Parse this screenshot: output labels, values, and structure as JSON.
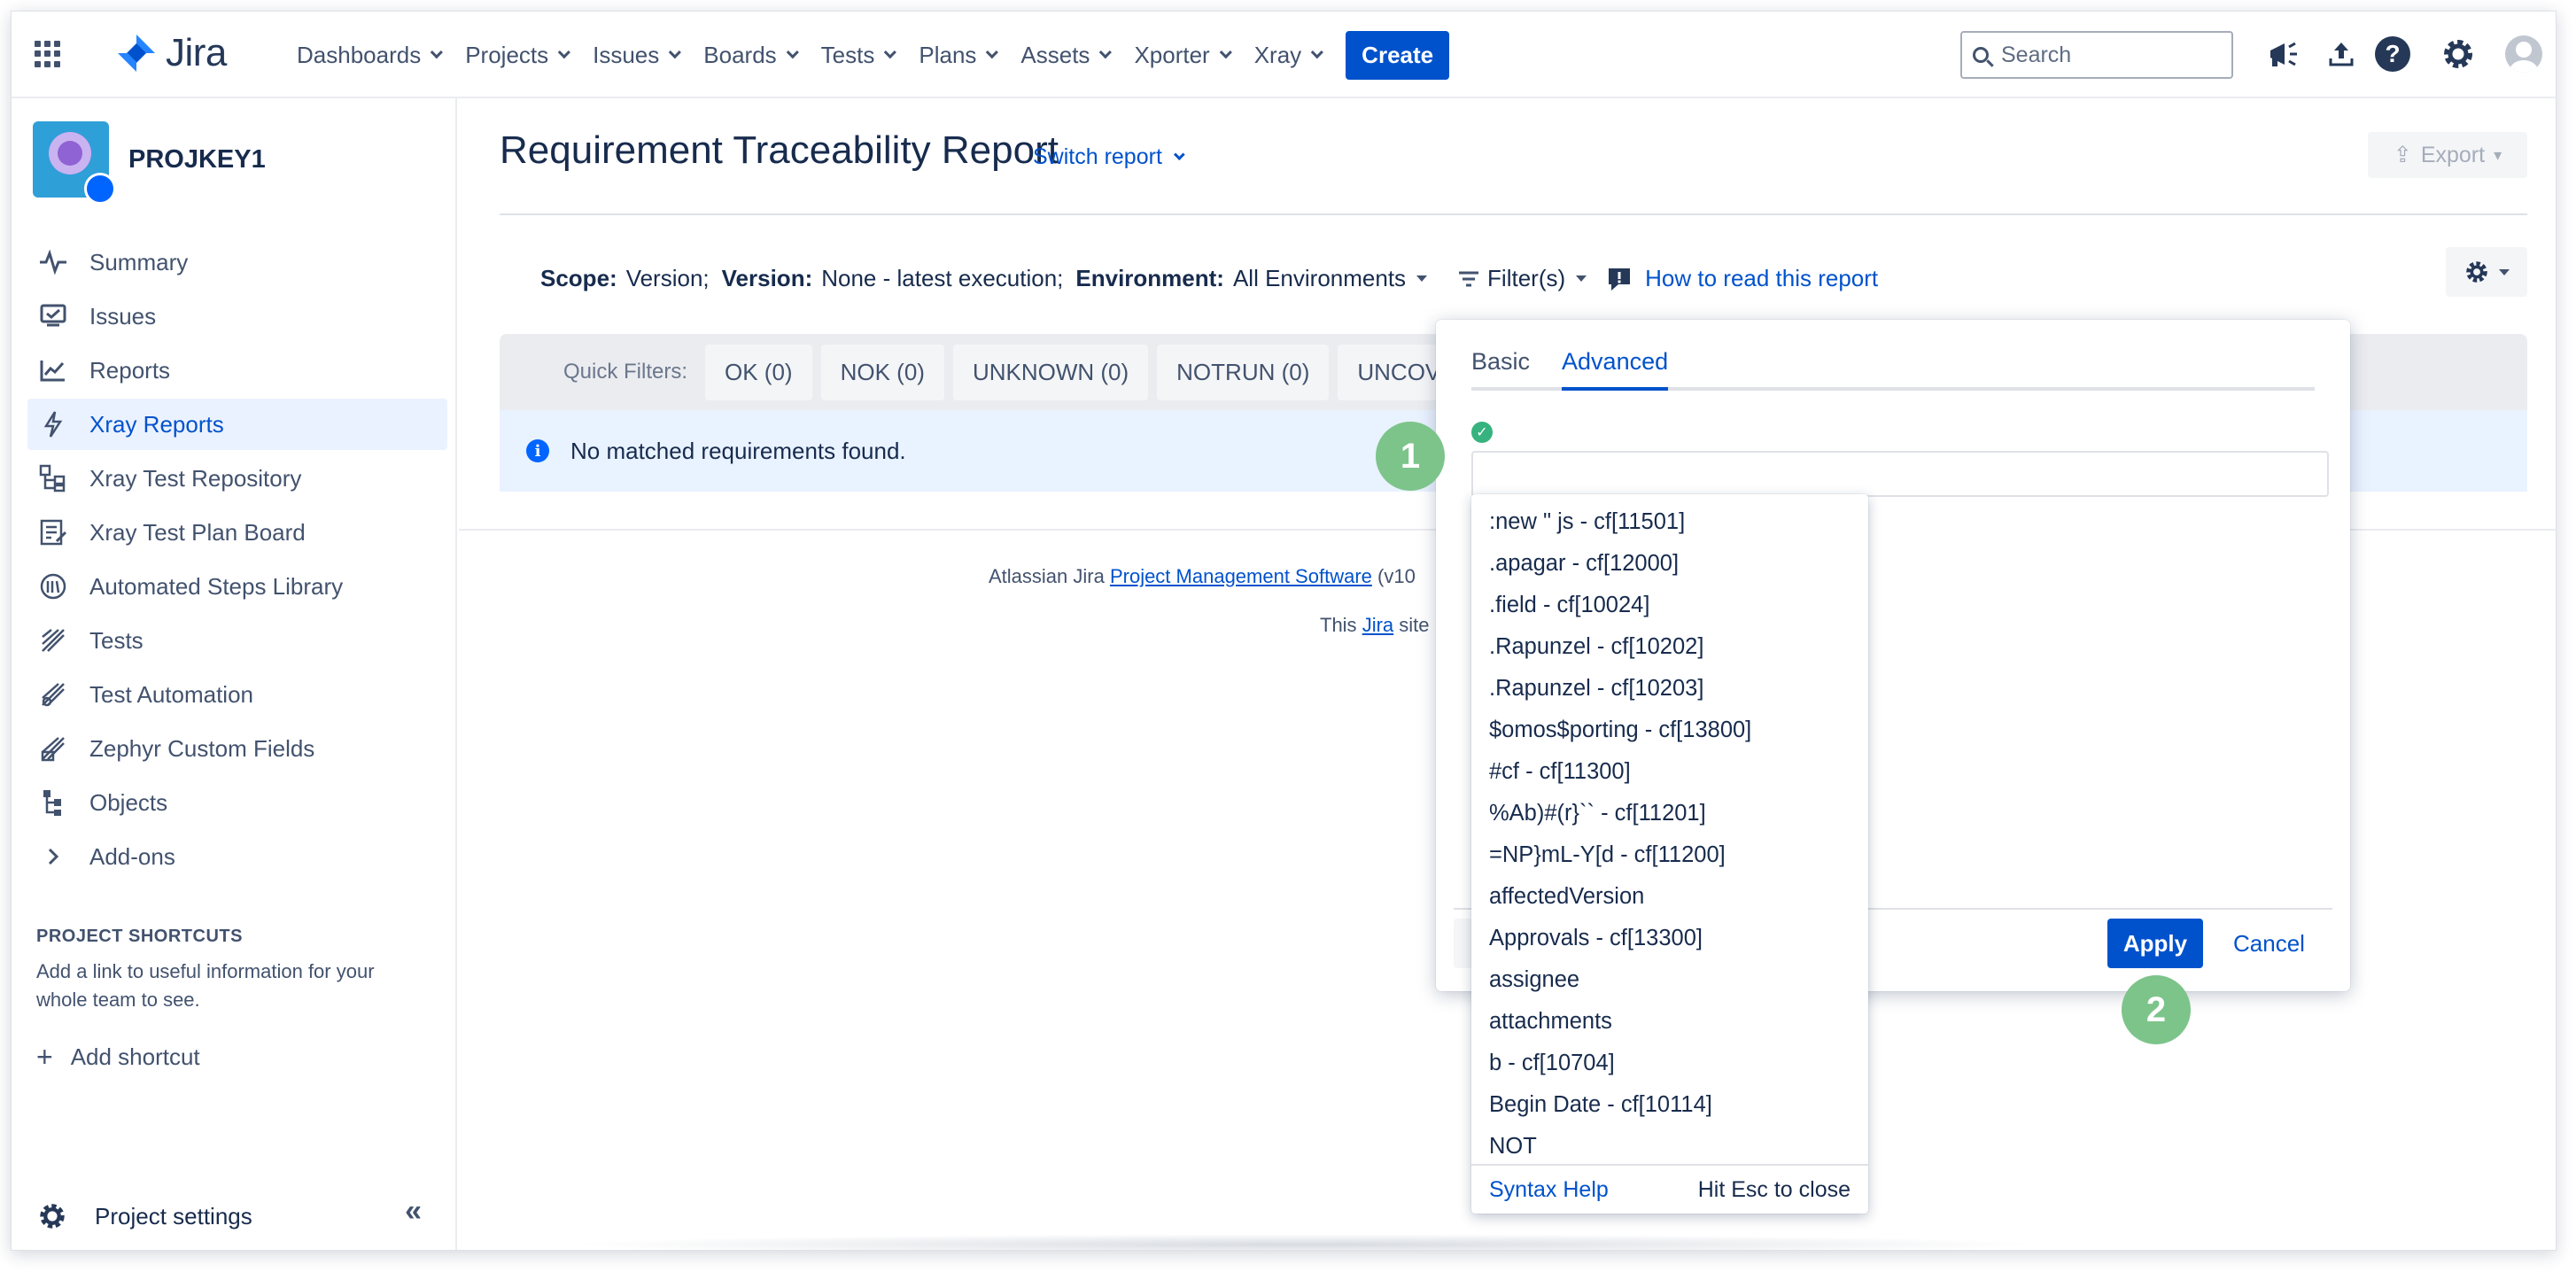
{
  "app": {
    "logo_text": "Jira"
  },
  "topnav": {
    "items": [
      {
        "label": "Dashboards"
      },
      {
        "label": "Projects"
      },
      {
        "label": "Issues"
      },
      {
        "label": "Boards"
      },
      {
        "label": "Tests"
      },
      {
        "label": "Plans"
      },
      {
        "label": "Assets"
      },
      {
        "label": "Xporter"
      },
      {
        "label": "Xray"
      }
    ],
    "create_label": "Create",
    "search_placeholder": "Search",
    "icons": [
      "notifications-megaphone-icon",
      "upload-icon",
      "help-icon",
      "settings-gear-icon",
      "profile-avatar-icon"
    ]
  },
  "sidebar": {
    "project_name": "PROJKEY1",
    "items": [
      {
        "label": "Summary",
        "icon": "pulse-icon"
      },
      {
        "label": "Issues",
        "icon": "issues-icon"
      },
      {
        "label": "Reports",
        "icon": "chart-icon"
      },
      {
        "label": "Xray Reports",
        "icon": "lightning-icon",
        "active": true
      },
      {
        "label": "Xray Test Repository",
        "icon": "repository-icon"
      },
      {
        "label": "Xray Test Plan Board",
        "icon": "plan-board-icon"
      },
      {
        "label": "Automated Steps Library",
        "icon": "steps-library-icon"
      },
      {
        "label": "Tests",
        "icon": "tests-icon"
      },
      {
        "label": "Test Automation",
        "icon": "automation-icon"
      },
      {
        "label": "Zephyr Custom Fields",
        "icon": "zephyr-icon"
      },
      {
        "label": "Objects",
        "icon": "objects-icon"
      },
      {
        "label": "Add-ons",
        "icon": "chevron-right-icon"
      }
    ],
    "shortcuts_title": "PROJECT SHORTCUTS",
    "shortcuts_note": "Add a link to useful information for your whole team to see.",
    "add_shortcut": "Add shortcut",
    "project_settings": "Project settings"
  },
  "main": {
    "title": "Requirement Traceability Report",
    "switch_report": "Switch report",
    "export_label": "Export",
    "scope": {
      "scope_label": "Scope:",
      "scope_value": "Version;",
      "version_label": "Version:",
      "version_value": "None - latest execution;",
      "env_label": "Environment:",
      "env_value": "All Environments",
      "filters_label": "Filter(s)",
      "how_to_read": "How to read this report"
    },
    "quick_filters": {
      "label": "Quick Filters:",
      "chips": [
        "OK (0)",
        "NOK (0)",
        "UNKNOWN (0)",
        "NOTRUN (0)",
        "UNCOVE"
      ]
    },
    "info_message": "No matched requirements found.",
    "footer": {
      "line1_prefix": "Atlassian Jira ",
      "line1_link": "Project Management Software",
      "line1_suffix": " (v10",
      "line2_prefix": "This ",
      "line2_link": "Jira",
      "line2_suffix": " site"
    }
  },
  "filter_panel": {
    "tabs": [
      "Basic",
      "Advanced"
    ],
    "active_tab": "Advanced",
    "query_value": "",
    "apply_label": "Apply",
    "cancel_label": "Cancel"
  },
  "autocomplete": {
    "items": [
      ":new \" js - cf[11501]",
      ".apagar - cf[12000]",
      ".field - cf[10024]",
      ".Rapunzel - cf[10202]",
      ".Rapunzel - cf[10203]",
      "$omos$porting - cf[13800]",
      "#cf - cf[11300]",
      "%Ab)#(r}`` - cf[11201]",
      "=NP}mL-Y[d - cf[11200]",
      "affectedVersion",
      "Approvals - cf[13300]",
      "assignee",
      "attachments",
      "b - cf[10704]",
      "Begin Date - cf[10114]",
      "NOT"
    ],
    "syntax_help": "Syntax Help",
    "esc_hint": "Hit Esc to close"
  },
  "markers": {
    "one": "1",
    "two": "2"
  },
  "colors": {
    "primary": "#0052cc",
    "marker": "#7dc48a",
    "info_bg": "#e9f2ff",
    "success": "#36b37e"
  }
}
